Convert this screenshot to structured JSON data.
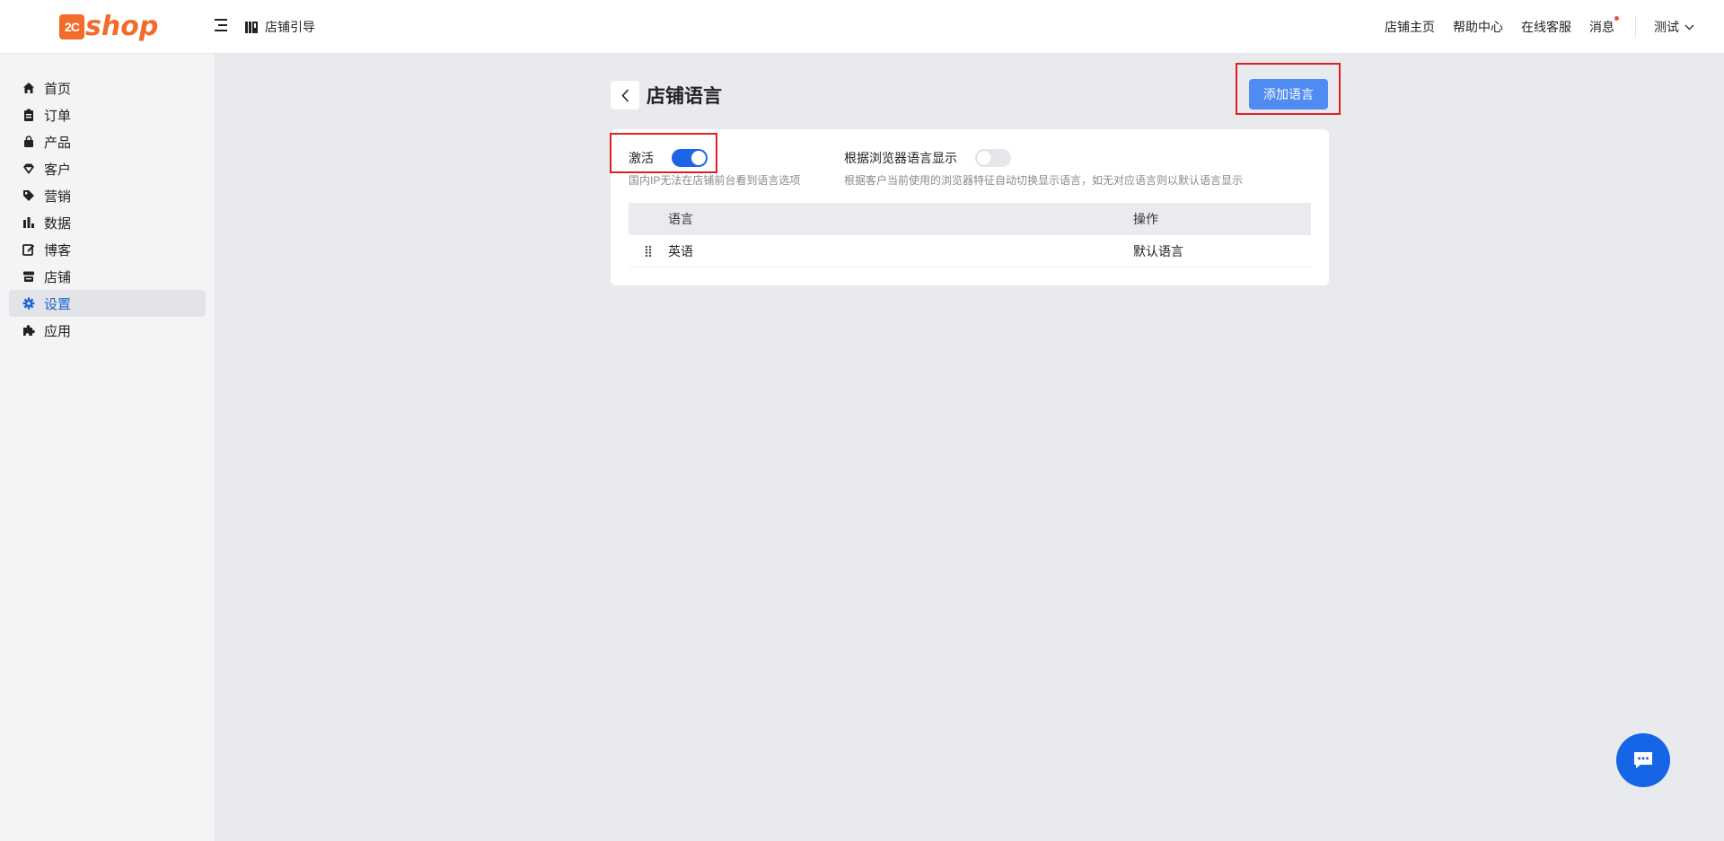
{
  "header": {
    "logo_prefix": "2C",
    "logo_word": "shop",
    "guide_label": "店铺引导",
    "nav": [
      "店铺主页",
      "帮助中心",
      "在线客服",
      "消息"
    ],
    "user_label": "测试"
  },
  "sidebar": {
    "items": [
      {
        "label": "首页",
        "icon": "home-icon"
      },
      {
        "label": "订单",
        "icon": "clipboard-icon"
      },
      {
        "label": "产品",
        "icon": "bag-icon"
      },
      {
        "label": "客户",
        "icon": "gem-icon"
      },
      {
        "label": "营销",
        "icon": "tag-icon"
      },
      {
        "label": "数据",
        "icon": "bar-chart-icon"
      },
      {
        "label": "博客",
        "icon": "edit-icon"
      },
      {
        "label": "店铺",
        "icon": "store-icon"
      },
      {
        "label": "设置",
        "icon": "gear-icon"
      },
      {
        "label": "应用",
        "icon": "puzzle-icon"
      }
    ],
    "active_index": 8
  },
  "page": {
    "title": "店铺语言",
    "add_button": "添加语言"
  },
  "settings": {
    "activate_label": "激活",
    "activate_on": true,
    "activate_hint": "国内IP无法在店铺前台看到语言选项",
    "browser_label": "根据浏览器语言显示",
    "browser_on": false,
    "browser_hint": "根据客户当前使用的浏览器特征自动切换显示语言，如无对应语言则以默认语言显示"
  },
  "table": {
    "headers": [
      "语言",
      "操作"
    ],
    "rows": [
      {
        "language": "英语",
        "action": "默认语言"
      }
    ]
  },
  "colors": {
    "accent": "#1c65e8",
    "button": "#4e8cf2",
    "brand": "#f26b2c",
    "highlight": "#e02020"
  }
}
